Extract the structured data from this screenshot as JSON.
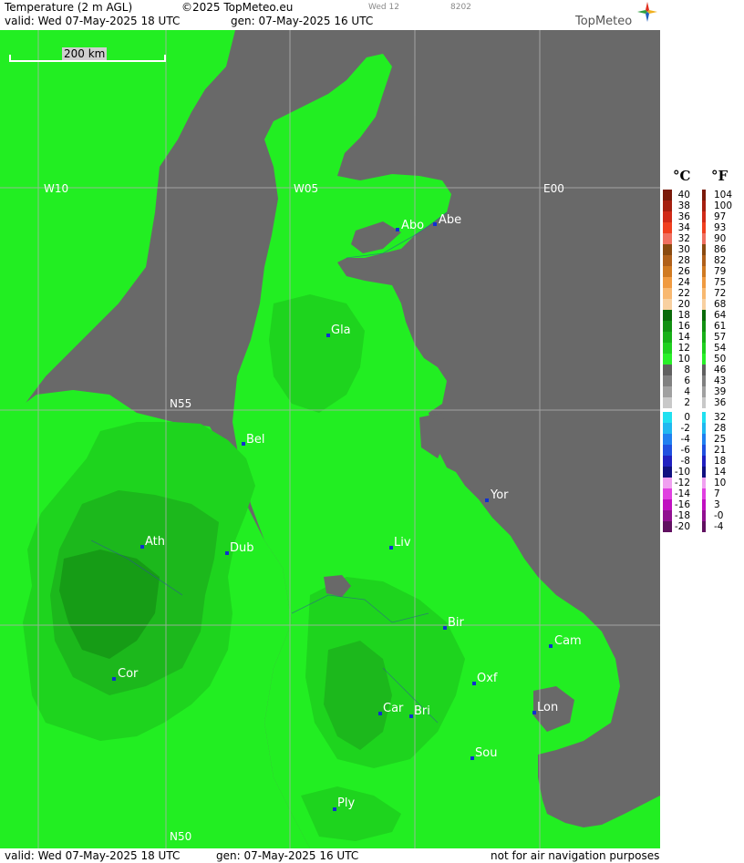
{
  "header": {
    "title": "Temperature (2 m AGL)",
    "copyright": "©2025 TopMeteo.eu",
    "daycode": "Wed 12",
    "code": "8202",
    "valid": "valid:  Wed  07-May-2025  18 UTC",
    "gen": "gen: 07-May-2025 16 UTC",
    "brand": "TopMeteo"
  },
  "footer": {
    "valid": "valid:  Wed  07-May-2025  18 UTC",
    "gen": "gen: 07-May-2025 16 UTC",
    "note": "not for air navigation purposes"
  },
  "scale": {
    "label": "200 km"
  },
  "grid_labels": [
    "W10",
    "W05",
    "E00",
    "N55",
    "N50"
  ],
  "cities": [
    {
      "id": "abo",
      "label": "Abo"
    },
    {
      "id": "abe",
      "label": "Abe"
    },
    {
      "id": "gla",
      "label": "Gla"
    },
    {
      "id": "bel",
      "label": "Bel"
    },
    {
      "id": "yor",
      "label": "Yor"
    },
    {
      "id": "ath",
      "label": "Ath"
    },
    {
      "id": "dub",
      "label": "Dub"
    },
    {
      "id": "liv",
      "label": "Liv"
    },
    {
      "id": "bir",
      "label": "Bir"
    },
    {
      "id": "cam",
      "label": "Cam"
    },
    {
      "id": "cor",
      "label": "Cor"
    },
    {
      "id": "oxf",
      "label": "Oxf"
    },
    {
      "id": "car",
      "label": "Car"
    },
    {
      "id": "bri",
      "label": "Bri"
    },
    {
      "id": "lon",
      "label": "Lon"
    },
    {
      "id": "sou",
      "label": "Sou"
    },
    {
      "id": "ply",
      "label": "Ply"
    }
  ],
  "legend": {
    "unit_c": "°C",
    "unit_f": "°F",
    "rows": [
      {
        "c": "40",
        "f": "104",
        "color": "#7a1a0a"
      },
      {
        "c": "38",
        "f": "100",
        "color": "#a52010"
      },
      {
        "c": "36",
        "f": "97",
        "color": "#d02a18"
      },
      {
        "c": "34",
        "f": "93",
        "color": "#f04020"
      },
      {
        "c": "32",
        "f": "90",
        "color": "#f07060"
      },
      {
        "c": "30",
        "f": "86",
        "color": "#8a4a10"
      },
      {
        "c": "28",
        "f": "82",
        "color": "#b0601a"
      },
      {
        "c": "26",
        "f": "79",
        "color": "#d07a22"
      },
      {
        "c": "24",
        "f": "75",
        "color": "#f09a40"
      },
      {
        "c": "22",
        "f": "72",
        "color": "#f8b870"
      },
      {
        "c": "20",
        "f": "68",
        "color": "#f8d0a0"
      },
      {
        "c": "18",
        "f": "64",
        "color": "#0a6a0a"
      },
      {
        "c": "16",
        "f": "61",
        "color": "#129012"
      },
      {
        "c": "14",
        "f": "57",
        "color": "#18b018"
      },
      {
        "c": "12",
        "f": "54",
        "color": "#20d020"
      },
      {
        "c": "10",
        "f": "50",
        "color": "#28f028"
      },
      {
        "c": "8",
        "f": "46",
        "color": "#606060"
      },
      {
        "c": "6",
        "f": "43",
        "color": "#808080"
      },
      {
        "c": "4",
        "f": "39",
        "color": "#a0a0a0"
      },
      {
        "c": "2",
        "f": "36",
        "color": "#c8c8c8"
      },
      {
        "c": "0",
        "f": "32",
        "color": "#20e0f0"
      },
      {
        "c": "-2",
        "f": "28",
        "color": "#20b8f0"
      },
      {
        "c": "-4",
        "f": "25",
        "color": "#2080f0"
      },
      {
        "c": "-6",
        "f": "21",
        "color": "#2050e0"
      },
      {
        "c": "-8",
        "f": "18",
        "color": "#2020c0"
      },
      {
        "c": "-10",
        "f": "14",
        "color": "#101080"
      },
      {
        "c": "-12",
        "f": "10",
        "color": "#f0a0f0"
      },
      {
        "c": "-14",
        "f": "7",
        "color": "#e040e0"
      },
      {
        "c": "-16",
        "f": "3",
        "color": "#c010c0"
      },
      {
        "c": "-18",
        "f": "-0",
        "color": "#901090"
      },
      {
        "c": "-20",
        "f": "-4",
        "color": "#601060"
      }
    ]
  },
  "colors": {
    "sea": "#696969",
    "t10": "#22ee22",
    "t12": "#1ed41e",
    "t14": "#1cb81c",
    "t16": "#169c16",
    "t18": "#0f7f0f"
  }
}
